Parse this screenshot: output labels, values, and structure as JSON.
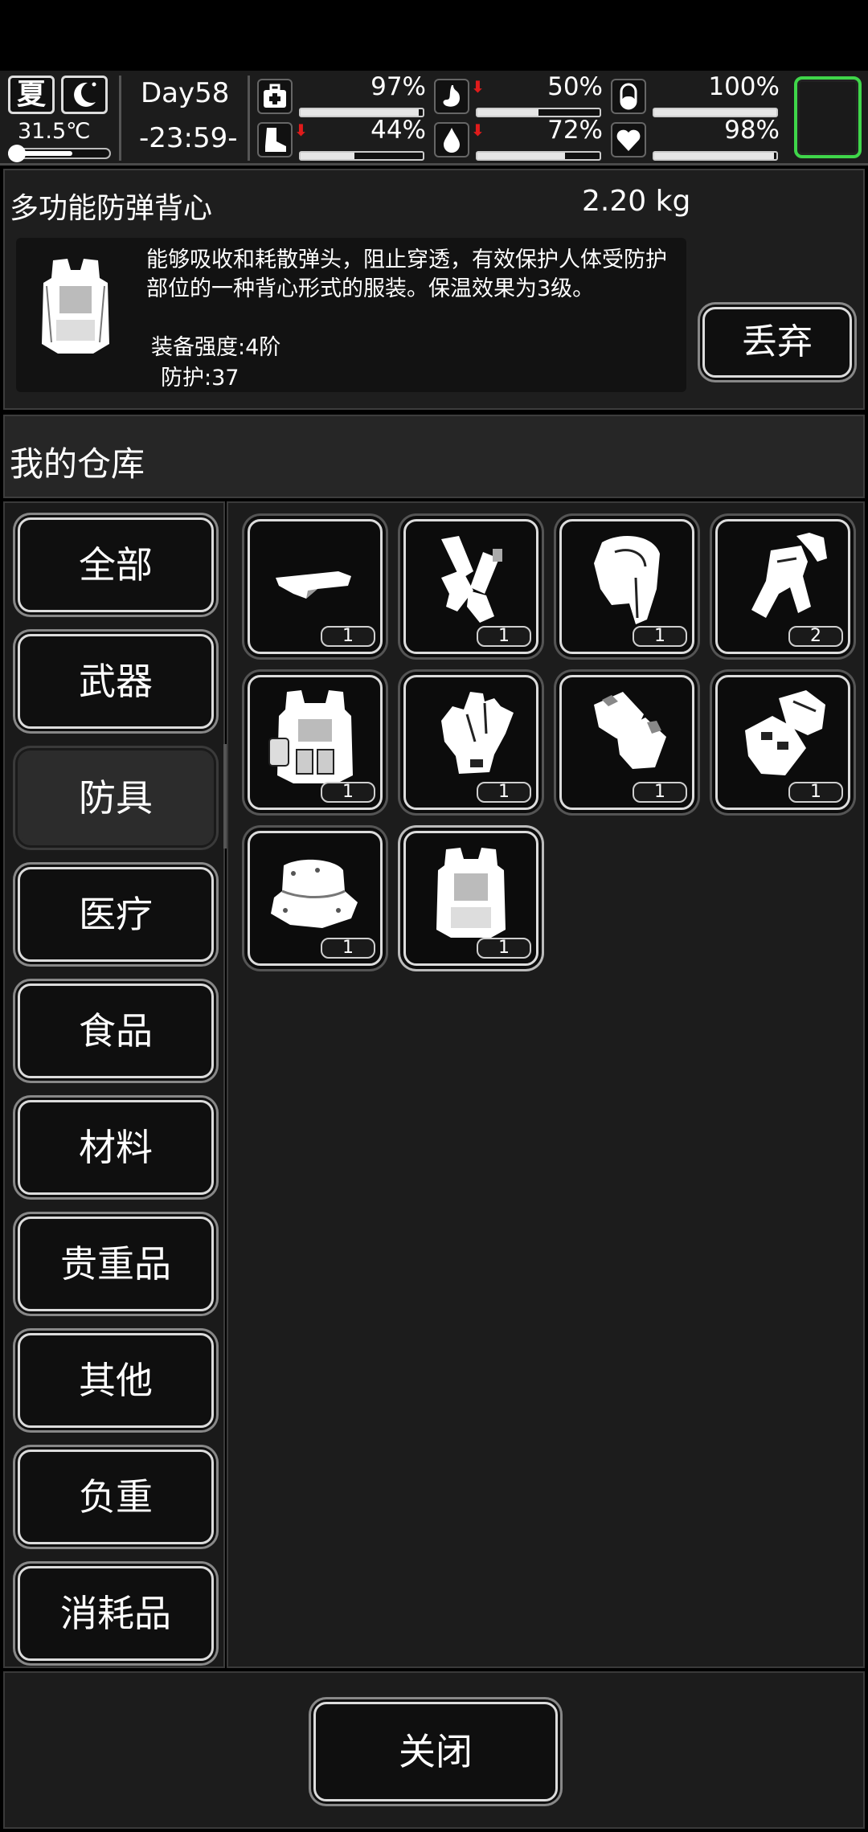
{
  "status": {
    "season": "夏",
    "temperature": "31.5℃",
    "temperature_level": 0.6,
    "day": "Day58",
    "time": "-23:59-",
    "stats": [
      {
        "name": "health",
        "icon": "medkit-icon",
        "value": "97%",
        "level": 0.97,
        "decreasing": false
      },
      {
        "name": "hunger",
        "icon": "stomach-icon",
        "value": "50%",
        "level": 0.5,
        "decreasing": true
      },
      {
        "name": "pill",
        "icon": "pill-icon",
        "value": "100%",
        "level": 1.0,
        "decreasing": false
      },
      {
        "name": "stamina",
        "icon": "boot-icon",
        "value": "44%",
        "level": 0.44,
        "decreasing": true
      },
      {
        "name": "thirst",
        "icon": "water-drop-icon",
        "value": "72%",
        "level": 0.72,
        "decreasing": true
      },
      {
        "name": "mood",
        "icon": "heart-icon",
        "value": "98%",
        "level": 0.98,
        "decreasing": false
      }
    ]
  },
  "detail": {
    "name": "多功能防弹背心",
    "weight": "2.20 kg",
    "description": "能够吸收和耗散弹头，阻止穿透，有效保护人体受防护部位的一种背心形式的服装。保温效果为3级。",
    "strength": "装备强度:4阶",
    "protection": "防护:37",
    "discard_label": "丢弃"
  },
  "warehouse": {
    "title": "我的仓库",
    "categories": [
      "全部",
      "武器",
      "防具",
      "医疗",
      "食品",
      "材料",
      "贵重品",
      "其他",
      "负重",
      "消耗品"
    ],
    "active_category": "防具",
    "items": [
      {
        "icon": "visor-cap-icon",
        "count": "1"
      },
      {
        "icon": "arm-sleeves-icon",
        "count": "1"
      },
      {
        "icon": "hood-icon",
        "count": "1"
      },
      {
        "icon": "tracksuit-icon",
        "count": "2"
      },
      {
        "icon": "tactical-vest-icon",
        "count": "1"
      },
      {
        "icon": "glove-icon",
        "count": "1"
      },
      {
        "icon": "fingerless-gloves-icon",
        "count": "1"
      },
      {
        "icon": "tactical-gloves-icon",
        "count": "1"
      },
      {
        "icon": "bucket-hat-icon",
        "count": "1"
      },
      {
        "icon": "bulletproof-vest-icon",
        "count": "1",
        "selected": true
      }
    ]
  },
  "footer": {
    "close_label": "关闭"
  }
}
